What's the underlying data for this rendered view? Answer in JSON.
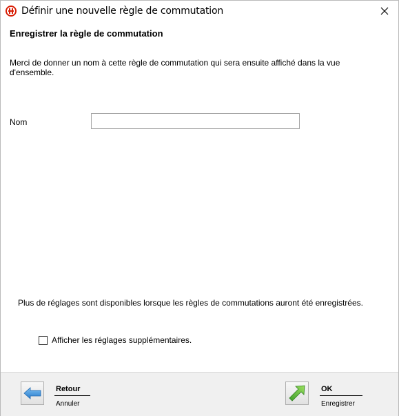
{
  "window": {
    "title": "Définir une nouvelle règle de commutation"
  },
  "main": {
    "section_title": "Enregistrer la règle de commutation",
    "description": "Merci de donner un nom à cette règle de commutation qui sera ensuite affiché dans la vue d'ensemble.",
    "name_label": "Nom",
    "name_value": "",
    "more_note": "Plus de réglages sont disponibles lorsque les règles de commutations auront été enregistrées.",
    "checkbox_label": "Afficher les réglages supplémentaires.",
    "checkbox_checked": false
  },
  "footer": {
    "back_label": "Retour",
    "back_sub": "Annuler",
    "ok_label": "OK",
    "ok_sub": "Enregistrer"
  },
  "icons": {
    "app": "app-logo-icon",
    "close": "close-icon",
    "back": "arrow-left-icon",
    "ok": "arrow-up-right-icon"
  },
  "colors": {
    "app_icon": "#d81e05",
    "back_arrow": "#3a8fd8",
    "ok_arrow": "#5fb53a",
    "footer_bg": "#f0f0f0"
  }
}
